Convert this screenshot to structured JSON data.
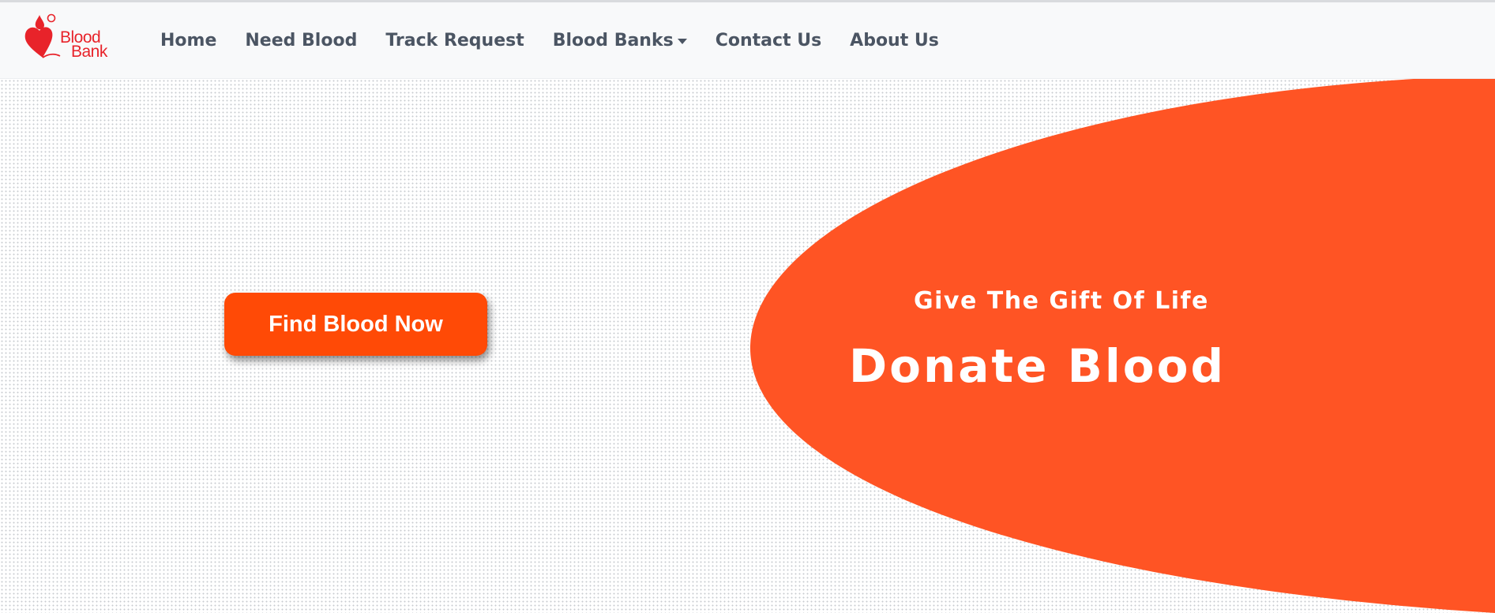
{
  "brand": {
    "logo_line1": "Blood",
    "logo_line2": "Bank",
    "logo_color": "#e8232a"
  },
  "nav": {
    "items": [
      {
        "label": "Home"
      },
      {
        "label": "Need Blood"
      },
      {
        "label": "Track Request"
      },
      {
        "label": "Blood Banks",
        "has_dropdown": true
      },
      {
        "label": "Contact Us"
      },
      {
        "label": "About Us"
      }
    ]
  },
  "hero": {
    "cta_label": "Find Blood Now",
    "subtitle": "Give The Gift Of Life",
    "title": "Donate Blood",
    "accent_color": "#ff5424",
    "button_color": "#ff4a06"
  },
  "icons": {
    "logo": "heart-blood-drop-logo",
    "dropdown": "caret-down-icon"
  }
}
